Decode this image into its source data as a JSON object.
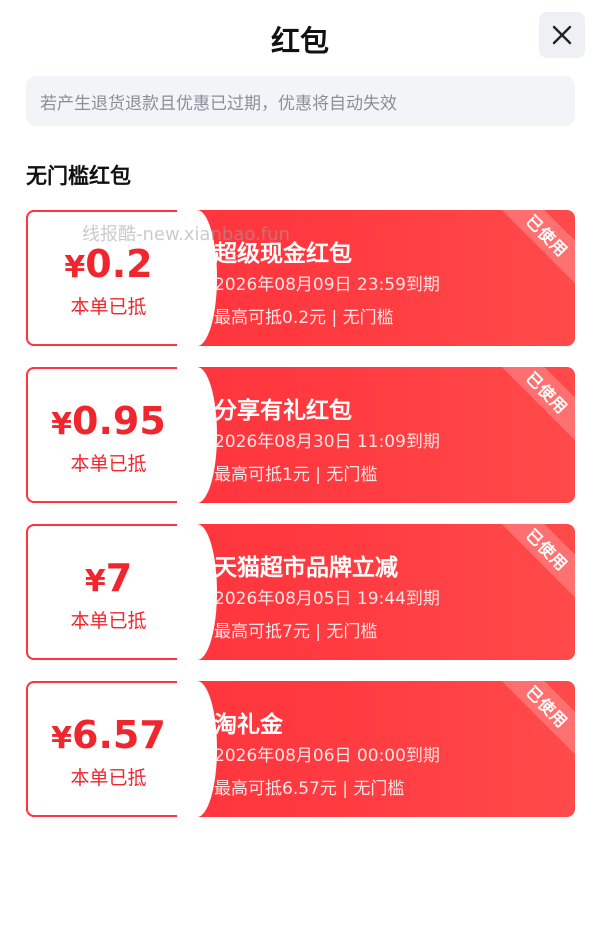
{
  "header": {
    "title": "红包",
    "close_icon": "close-icon"
  },
  "notice": "若产生退货退款且优惠已过期，优惠将自动失效",
  "section_title": "无门槛红包",
  "watermark": "线报酷-new.xianbao.fun",
  "colors": {
    "accent": "#f0262e",
    "coupon_bg": "#ff3a40",
    "notice_bg": "#f2f4f7"
  },
  "coupons": [
    {
      "currency": "¥",
      "amount": "0.2",
      "deduct_label": "本单已抵",
      "name": "超级现金红包",
      "expiry": "2026年08月09日 23:59到期",
      "limit": "最高可抵0.2元 | 无门槛",
      "status": "已使用"
    },
    {
      "currency": "¥",
      "amount": "0.95",
      "deduct_label": "本单已抵",
      "name": "分享有礼红包",
      "expiry": "2026年08月30日 11:09到期",
      "limit": "最高可抵1元 | 无门槛",
      "status": "已使用"
    },
    {
      "currency": "¥",
      "amount": "7",
      "deduct_label": "本单已抵",
      "name": "天猫超市品牌立减",
      "expiry": "2026年08月05日 19:44到期",
      "limit": "最高可抵7元 | 无门槛",
      "status": "已使用"
    },
    {
      "currency": "¥",
      "amount": "6.57",
      "deduct_label": "本单已抵",
      "name": "淘礼金",
      "expiry": "2026年08月06日 00:00到期",
      "limit": "最高可抵6.57元 | 无门槛",
      "status": "已使用"
    }
  ]
}
